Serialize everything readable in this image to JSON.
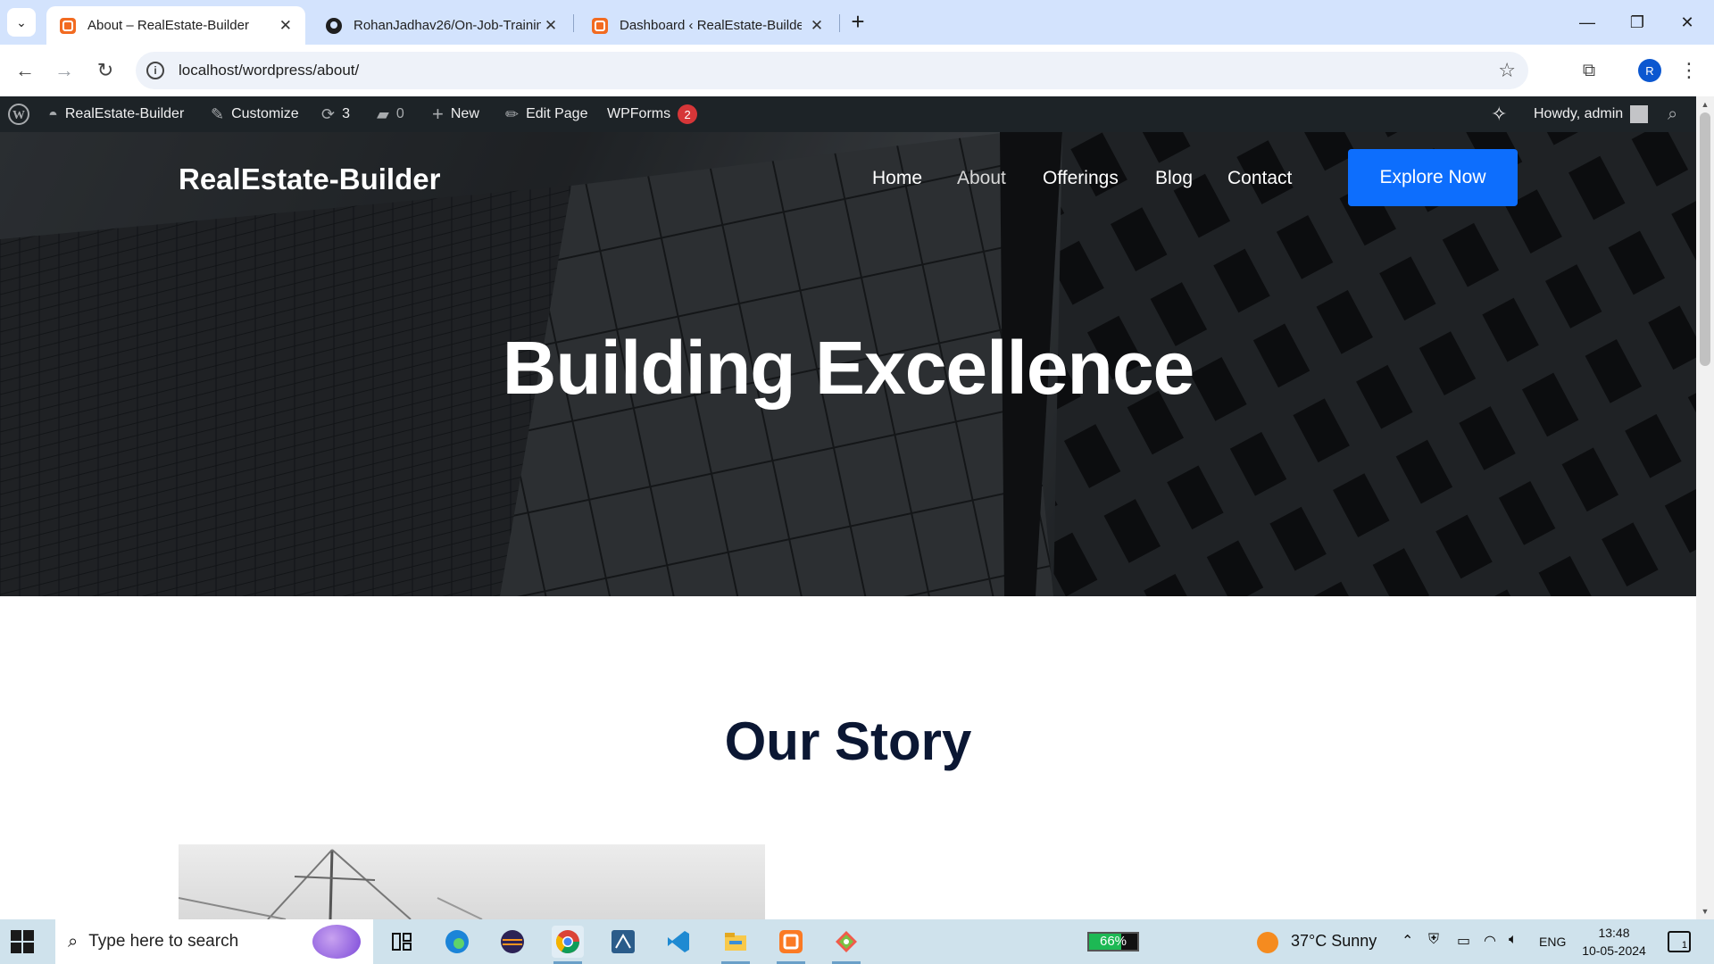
{
  "browser": {
    "tabs": [
      {
        "title": "About – RealEstate-Builder",
        "active": true
      },
      {
        "title": "RohanJadhav26/On-Job-Trainin",
        "active": false
      },
      {
        "title": "Dashboard ‹ RealEstate-Builder",
        "active": false
      }
    ],
    "url": "localhost/wordpress/about/",
    "profile_initial": "R"
  },
  "admin_bar": {
    "site_name": "RealEstate-Builder",
    "customize": "Customize",
    "updates_count": "3",
    "comments_count": "0",
    "new_label": "New",
    "edit_page": "Edit Page",
    "wpforms_label": "WPForms",
    "wpforms_badge": "2",
    "howdy": "Howdy, admin"
  },
  "site": {
    "brand": "RealEstate-Builder",
    "nav": [
      "Home",
      "About",
      "Offerings",
      "Blog",
      "Contact"
    ],
    "current_nav": "About",
    "cta": "Explore Now",
    "hero_title": "Building Excellence",
    "section_title": "Our Story"
  },
  "taskbar": {
    "search_placeholder": "Type here to search",
    "battery_percent": "66%",
    "battery_level": 0.66,
    "weather": "37°C  Sunny",
    "lang": "ENG",
    "time": "13:48",
    "date": "10-05-2024",
    "notifications": "1"
  },
  "colors": {
    "accent": "#0d6efd",
    "admin_bar": "#1d2327",
    "heading": "#0b1733",
    "badge": "#d63638"
  }
}
